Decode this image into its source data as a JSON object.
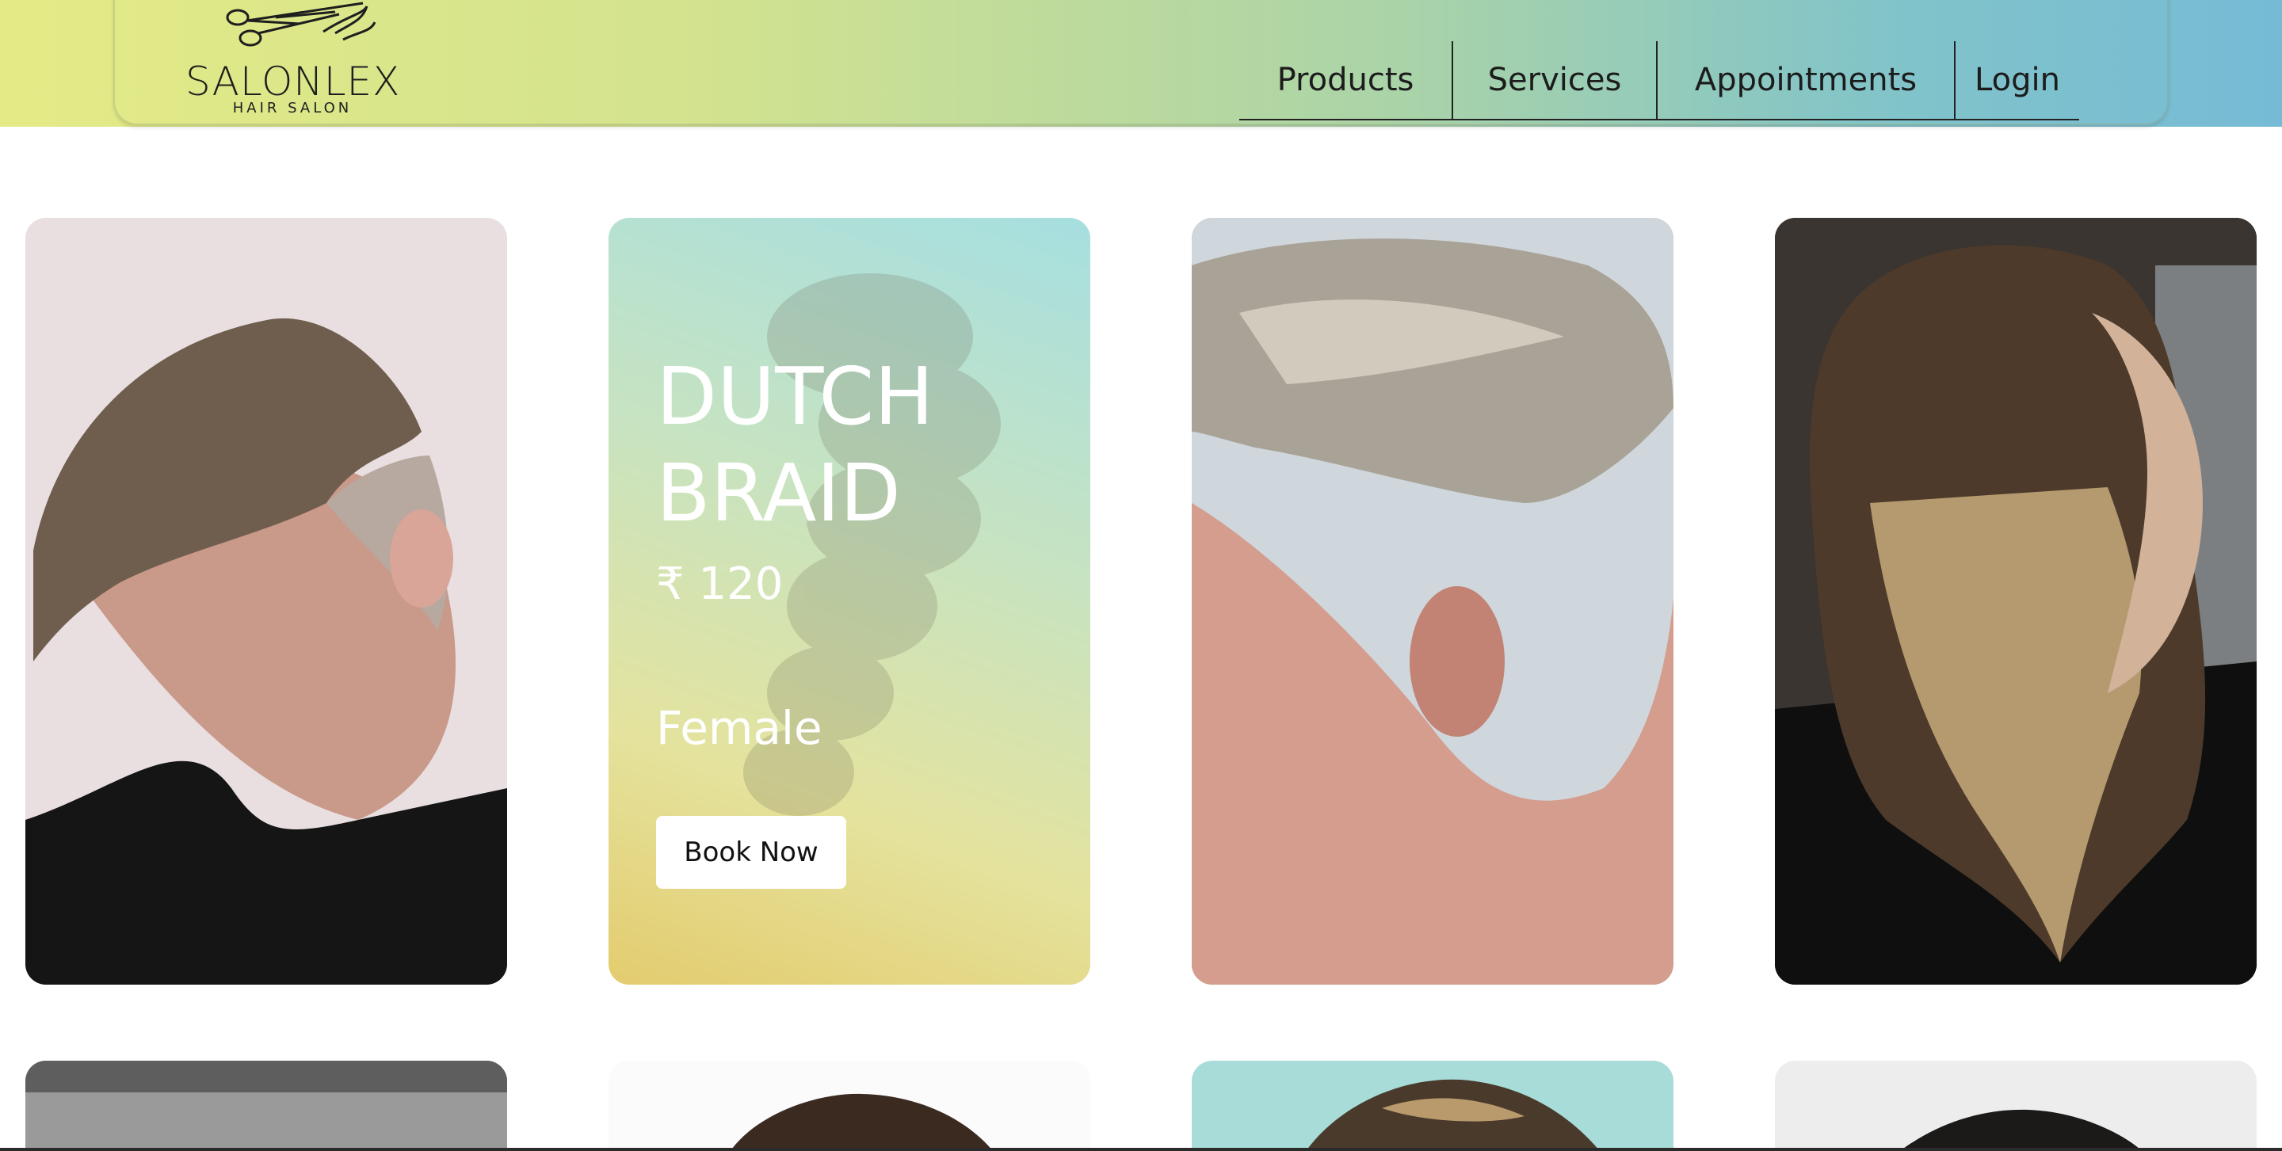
{
  "brand": {
    "name": "SALONLEX",
    "tagline": "HAIR SALON"
  },
  "nav": {
    "items": [
      {
        "label": "Products"
      },
      {
        "label": "Services"
      },
      {
        "label": "Appointments"
      },
      {
        "label": "Login"
      }
    ]
  },
  "featured_card": {
    "title": "DUTCH BRAID",
    "price": "₹ 120",
    "gender": "Female",
    "button_label": "Book Now"
  },
  "colors": {
    "header_gradient_start": "#e4ea86",
    "header_gradient_end": "#76bbd6",
    "card_text": "#ffffff",
    "button_bg": "#ffffff"
  },
  "icons": {
    "logo_mark": "scissors-comb-icon"
  }
}
